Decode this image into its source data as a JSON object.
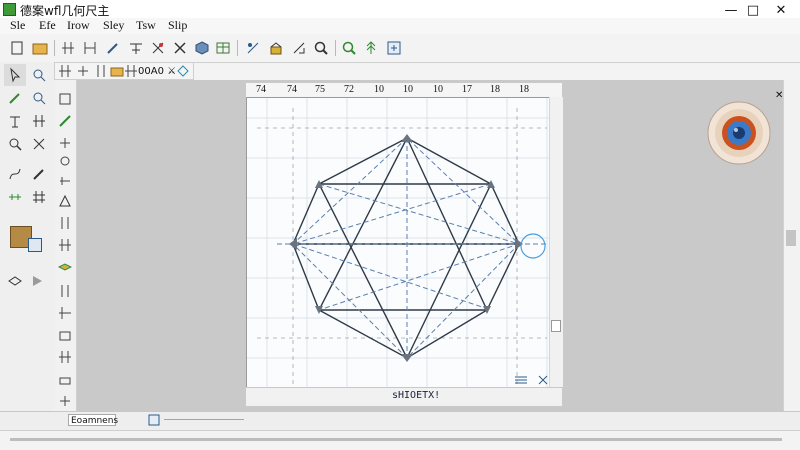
{
  "window": {
    "title": "德案wfl几何尺主",
    "minimize": "—",
    "maximize": "□",
    "close": "✕"
  },
  "menu": [
    {
      "label": "Sle"
    },
    {
      "label": "Efe"
    },
    {
      "label": "Irow"
    },
    {
      "label": "Sley"
    },
    {
      "label": "Tsw"
    },
    {
      "label": "Slip"
    }
  ],
  "toolbar": {
    "icons": [
      "new-page-icon",
      "open-folder-icon",
      "grid-icon",
      "dimension-icon",
      "cut-icon",
      "pen-icon",
      "mirror-icon",
      "intersect-icon",
      "cube-icon",
      "table-icon",
      "measure-icon",
      "build-icon",
      "scale-icon",
      "search-icon",
      "zoom-icon",
      "tree-icon",
      "export-icon"
    ]
  },
  "subtoolbar": {
    "zoom_label": "00A0 ⚔"
  },
  "ruler": {
    "labels": [
      "74",
      "74",
      "75",
      "72",
      "10",
      "10",
      "10",
      "17",
      "18",
      "18"
    ]
  },
  "sheet": {
    "status_text": "sHIOEТX!"
  },
  "statusbar": {
    "field_text": "Eoamnens"
  },
  "colors": {
    "accent": "#2b5a8a",
    "dashed": "#5a7fae",
    "highlight": "#4aa0e0"
  }
}
